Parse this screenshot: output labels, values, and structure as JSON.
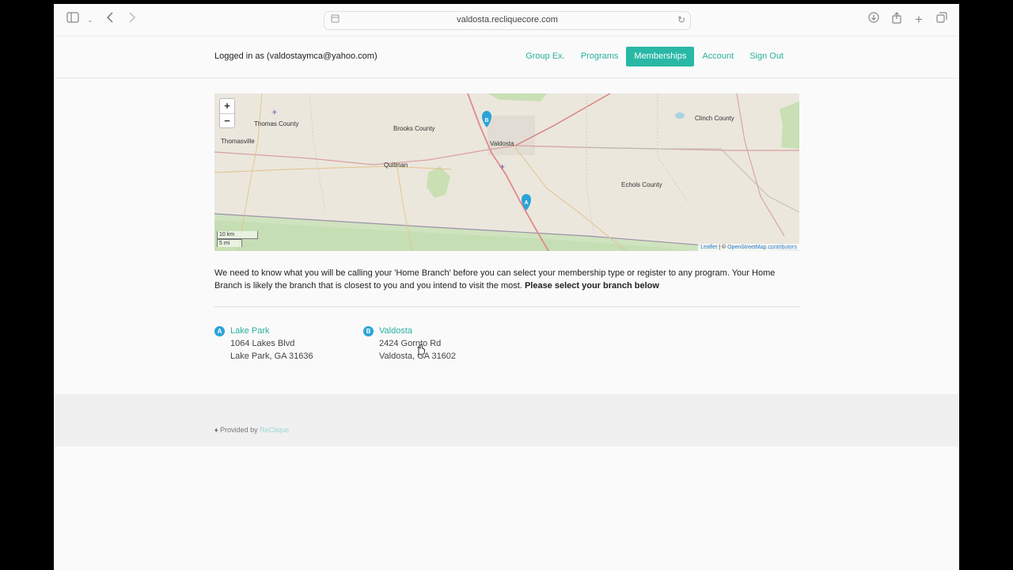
{
  "browser": {
    "url": "valdosta.recliquecore.com"
  },
  "header": {
    "logged_in_text": "Logged in as (valdostaymca@yahoo.com)",
    "nav": [
      {
        "label": "Group Ex.",
        "active": false
      },
      {
        "label": "Programs",
        "active": false
      },
      {
        "label": "Memberships",
        "active": true
      },
      {
        "label": "Account",
        "active": false
      },
      {
        "label": "Sign Out",
        "active": false
      }
    ]
  },
  "map": {
    "zoom_in": "+",
    "zoom_out": "−",
    "scale_km": "10 km",
    "scale_mi": "5 mi",
    "attribution_leaflet": "Leaflet",
    "attribution_sep": " | © ",
    "attribution_osm": "OpenStreetMap contributors",
    "labels": {
      "valdosta": "Valdosta",
      "thomasville": "Thomasville",
      "quitman": "Quitman",
      "brooks": "Brooks County",
      "thomas": "Thomas County",
      "clinch": "Clinch County",
      "echols": "Echols County"
    },
    "markers": [
      "A",
      "B"
    ]
  },
  "message": {
    "text": "We need to know what you will be calling your 'Home Branch' before you can select your membership type or register to any program. Your Home Branch is likely the branch that is closest to you and you intend to visit the most.",
    "bold": "Please select your branch below"
  },
  "branches": [
    {
      "letter": "A",
      "name": "Lake Park",
      "street": "1064 Lakes Blvd",
      "city": "Lake Park, GA 31636"
    },
    {
      "letter": "B",
      "name": "Valdosta",
      "street": "2424 Gornto Rd",
      "city": "Valdosta, GA 31602"
    }
  ],
  "footer": {
    "provided_by": "Provided by",
    "brand": "ReClique"
  },
  "colors": {
    "accent": "#2ab8a6",
    "marker": "#2aa3d8"
  }
}
